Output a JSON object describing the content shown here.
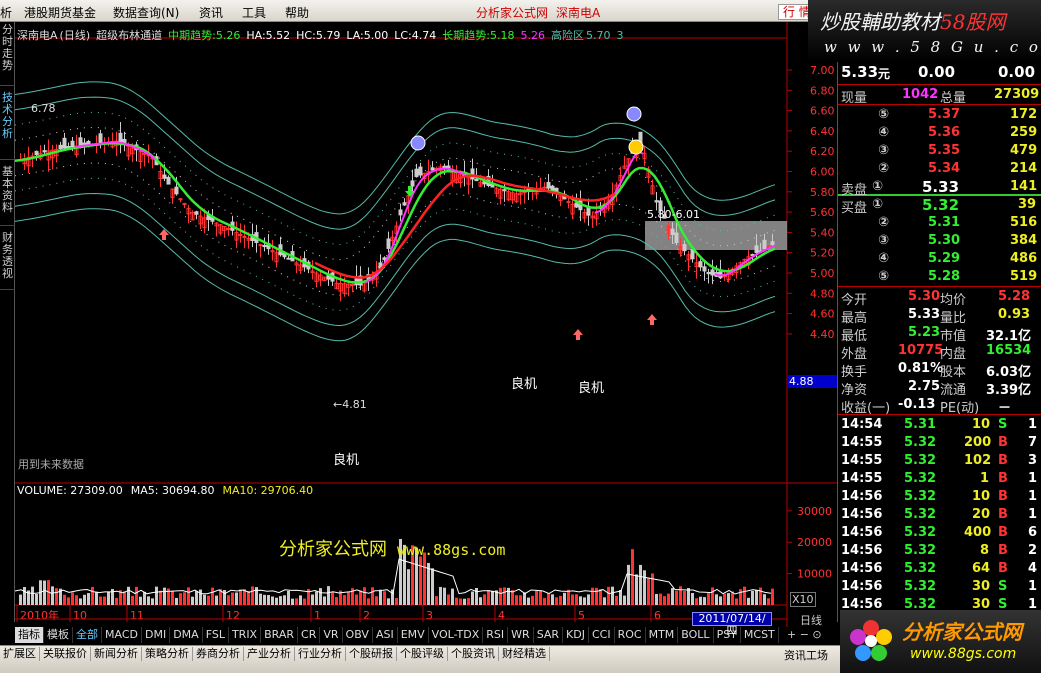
{
  "menu": {
    "items": [
      "析",
      "港股期货基金",
      "数据查询(N)",
      "资讯",
      "工具",
      "帮助"
    ],
    "brand_title": "分析家公式网",
    "stock_title": "深南电A",
    "quote_button": "行 情"
  },
  "watermark_top": {
    "line1_a": "炒股輔助教材",
    "line1_b": "58股网",
    "line2": "w w w . 5 8 G u . c o m"
  },
  "left_tabs": [
    "分时走势",
    "技术分析",
    "基本资料",
    "财务透视"
  ],
  "main_header": {
    "stock": "深南电A",
    "period": "(日线)",
    "indicator": "超级布林通道",
    "mid_trend_label": "中期趋势:",
    "mid_trend_value": "5.26",
    "ha_label": "HA:",
    "ha_value": "5.52",
    "hc_label": "HC:",
    "hc_value": "5.79",
    "la_label": "LA:",
    "la_value": "5.00",
    "lc_label": "LC:",
    "lc_value": "4.74",
    "long_trend_label": "长期趋势:",
    "long_trend_value": "5.18",
    "extra_value": "5.26",
    "zone_label": "高险区",
    "zone_value": "5.70",
    "zone_tail": "3"
  },
  "chart_annotations": {
    "high_label": "6.78",
    "low_label": "←4.81",
    "range_label": "5.80-6.01",
    "opportunity": [
      "良机",
      "良机",
      "良机"
    ],
    "future_note": "用到未来数据"
  },
  "price_axis": [
    "7.00",
    "6.80",
    "6.60",
    "6.40",
    "6.20",
    "6.00",
    "5.80",
    "5.60",
    "5.40",
    "5.20",
    "5.00",
    "4.80",
    "4.60",
    "4.40"
  ],
  "current_price_tag": "4.88",
  "volume_header": {
    "volume": "VOLUME: 27309.00",
    "ma5": "MA5: 30694.80",
    "ma10": "MA10: 29706.40"
  },
  "volume_axis": [
    "30000",
    "20000",
    "10000"
  ],
  "date_axis": [
    "2010年",
    "10",
    "11",
    "12",
    "1",
    "2",
    "3",
    "4",
    "5",
    "6"
  ],
  "date_box": "2011/07/14/四",
  "x10": "X10",
  "rili": "日线",
  "watermark_mid": {
    "text": "分析家公式网",
    "url": "www.88gs.com"
  },
  "quote": {
    "price": "5.33",
    "price_unit": "元",
    "change": "0.00",
    "change_pct": "0.00",
    "current_vol_label": "现量",
    "current_vol": "1042",
    "total_vol_label": "总量",
    "total_vol": "27309",
    "asks": [
      {
        "level": "⑤",
        "price": "5.37",
        "vol": "172"
      },
      {
        "level": "④",
        "price": "5.36",
        "vol": "259"
      },
      {
        "level": "③",
        "price": "5.35",
        "vol": "479"
      },
      {
        "level": "②",
        "price": "5.34",
        "vol": "214"
      }
    ],
    "sell1": {
      "label": "卖盘",
      "level": "①",
      "price": "5.33",
      "vol": "141"
    },
    "buy1": {
      "label": "买盘",
      "level": "①",
      "price": "5.32",
      "vol": "39"
    },
    "bids": [
      {
        "level": "②",
        "price": "5.31",
        "vol": "516"
      },
      {
        "level": "③",
        "price": "5.30",
        "vol": "384"
      },
      {
        "level": "④",
        "price": "5.29",
        "vol": "486"
      },
      {
        "level": "⑤",
        "price": "5.28",
        "vol": "519"
      }
    ],
    "stats": [
      {
        "l1": "今开",
        "v1": "5.30",
        "l2": "均价",
        "v2": "5.28"
      },
      {
        "l1": "最高",
        "v1": "5.33",
        "l2": "量比",
        "v2": "0.93"
      },
      {
        "l1": "最低",
        "v1": "5.23",
        "l2": "市值",
        "v2": "32.1亿"
      },
      {
        "l1": "外盘",
        "v1": "10775",
        "l2": "内盘",
        "v2": "16534"
      },
      {
        "l1": "换手",
        "v1": "0.81%",
        "l2": "股本",
        "v2": "6.03亿"
      },
      {
        "l1": "净资",
        "v1": "2.75",
        "l2": "流通",
        "v2": "3.39亿"
      },
      {
        "l1": "收益(一)",
        "v1": "-0.13",
        "l2": "PE(动)",
        "v2": "－"
      }
    ],
    "ticks": [
      {
        "time": "14:54",
        "price": "5.31",
        "vol": "10",
        "bs": "S",
        "n": "1"
      },
      {
        "time": "14:55",
        "price": "5.32",
        "vol": "200",
        "bs": "B",
        "n": "7"
      },
      {
        "time": "14:55",
        "price": "5.32",
        "vol": "102",
        "bs": "B",
        "n": "3"
      },
      {
        "time": "14:55",
        "price": "5.32",
        "vol": "1",
        "bs": "B",
        "n": "1"
      },
      {
        "time": "14:56",
        "price": "5.32",
        "vol": "10",
        "bs": "B",
        "n": "1"
      },
      {
        "time": "14:56",
        "price": "5.32",
        "vol": "20",
        "bs": "B",
        "n": "1"
      },
      {
        "time": "14:56",
        "price": "5.32",
        "vol": "400",
        "bs": "B",
        "n": "6"
      },
      {
        "time": "14:56",
        "price": "5.32",
        "vol": "8",
        "bs": "B",
        "n": "2"
      },
      {
        "time": "14:56",
        "price": "5.32",
        "vol": "64",
        "bs": "B",
        "n": "4"
      },
      {
        "time": "14:56",
        "price": "5.32",
        "vol": "30",
        "bs": "S",
        "n": "1"
      },
      {
        "time": "14:56",
        "price": "5.32",
        "vol": "30",
        "bs": "S",
        "n": "1"
      }
    ]
  },
  "indicator_tabs": [
    "指标",
    "模板",
    "全部",
    "MACD",
    "DMI",
    "DMA",
    "FSL",
    "TRIX",
    "BRAR",
    "CR",
    "VR",
    "OBV",
    "ASI",
    "EMV",
    "VOL-TDX",
    "RSI",
    "WR",
    "SAR",
    "KDJ",
    "CCI",
    "ROC",
    "MTM",
    "BOLL",
    "PSY",
    "MCST"
  ],
  "nav_buttons": "+ − ⊙",
  "bottom_tabs": [
    "扩展区",
    "关联报价",
    "新闻分析",
    "策略分析",
    "券商分析",
    "产业分析",
    "行业分析",
    "个股研报",
    "个股评级",
    "个股资讯",
    "财经精选"
  ],
  "bottom_right": "资讯工场",
  "watermark_bottom": {
    "title": "分析家公式网",
    "url": "www.88gs.com"
  },
  "colors": {
    "up": "#ff3333",
    "down": "#33dd33",
    "mid_line": "#ff2222",
    "trend_line": "#33ee33",
    "magenta_line": "#ff33ff",
    "band": "#55bbaa",
    "accent_yellow": "#eeee22"
  }
}
